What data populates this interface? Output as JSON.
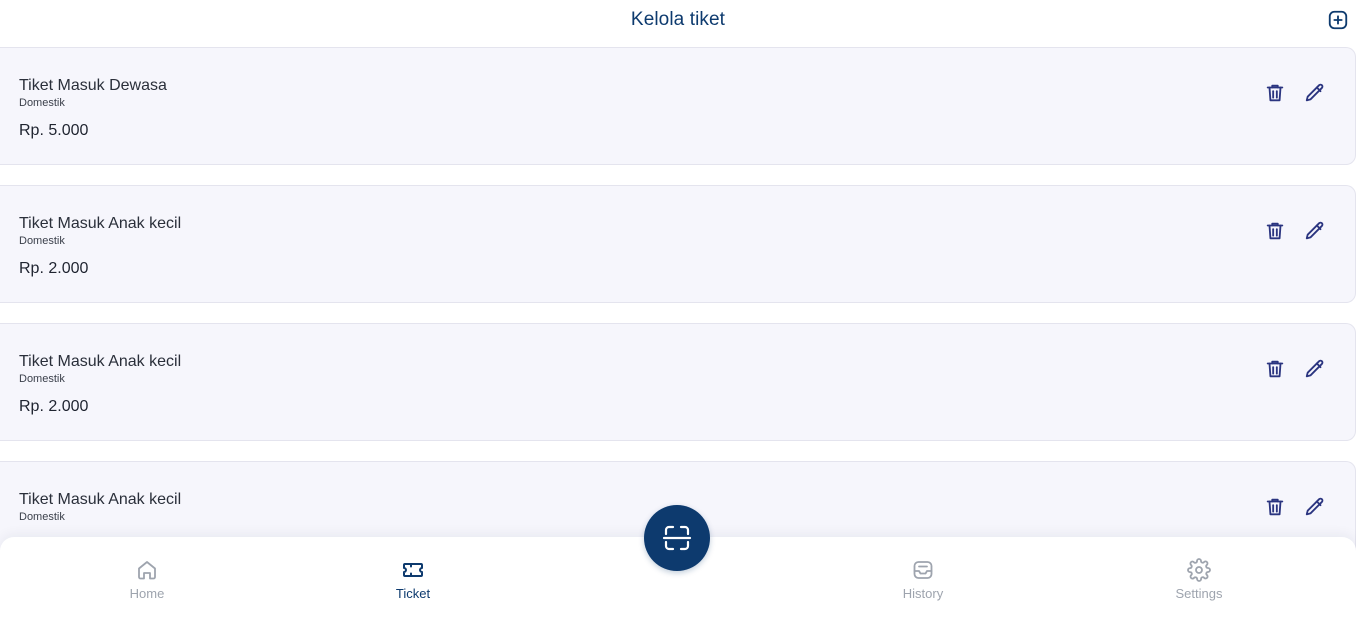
{
  "header": {
    "title": "Kelola tiket",
    "add_icon": "plus-square-icon"
  },
  "tickets": [
    {
      "name": "Tiket Masuk Dewasa",
      "category": "Domestik",
      "price": "Rp. 5.000"
    },
    {
      "name": "Tiket Masuk Anak kecil",
      "category": "Domestik",
      "price": "Rp. 2.000"
    },
    {
      "name": "Tiket Masuk Anak kecil",
      "category": "Domestik",
      "price": "Rp. 2.000"
    },
    {
      "name": "Tiket Masuk Anak kecil",
      "category": "Domestik",
      "price": ""
    }
  ],
  "nav": {
    "items": [
      {
        "label": "Home",
        "icon": "home-icon"
      },
      {
        "label": "Ticket",
        "icon": "ticket-icon"
      },
      {
        "label": "History",
        "icon": "inbox-icon"
      },
      {
        "label": "Settings",
        "icon": "gear-icon"
      }
    ],
    "active": "Ticket",
    "scan_icon": "scan-icon"
  },
  "colors": {
    "primary": "#0d3a6e",
    "action_icon": "#2b3580",
    "card_bg": "#f6f6fc",
    "nav_inactive": "#9ea4ae"
  }
}
